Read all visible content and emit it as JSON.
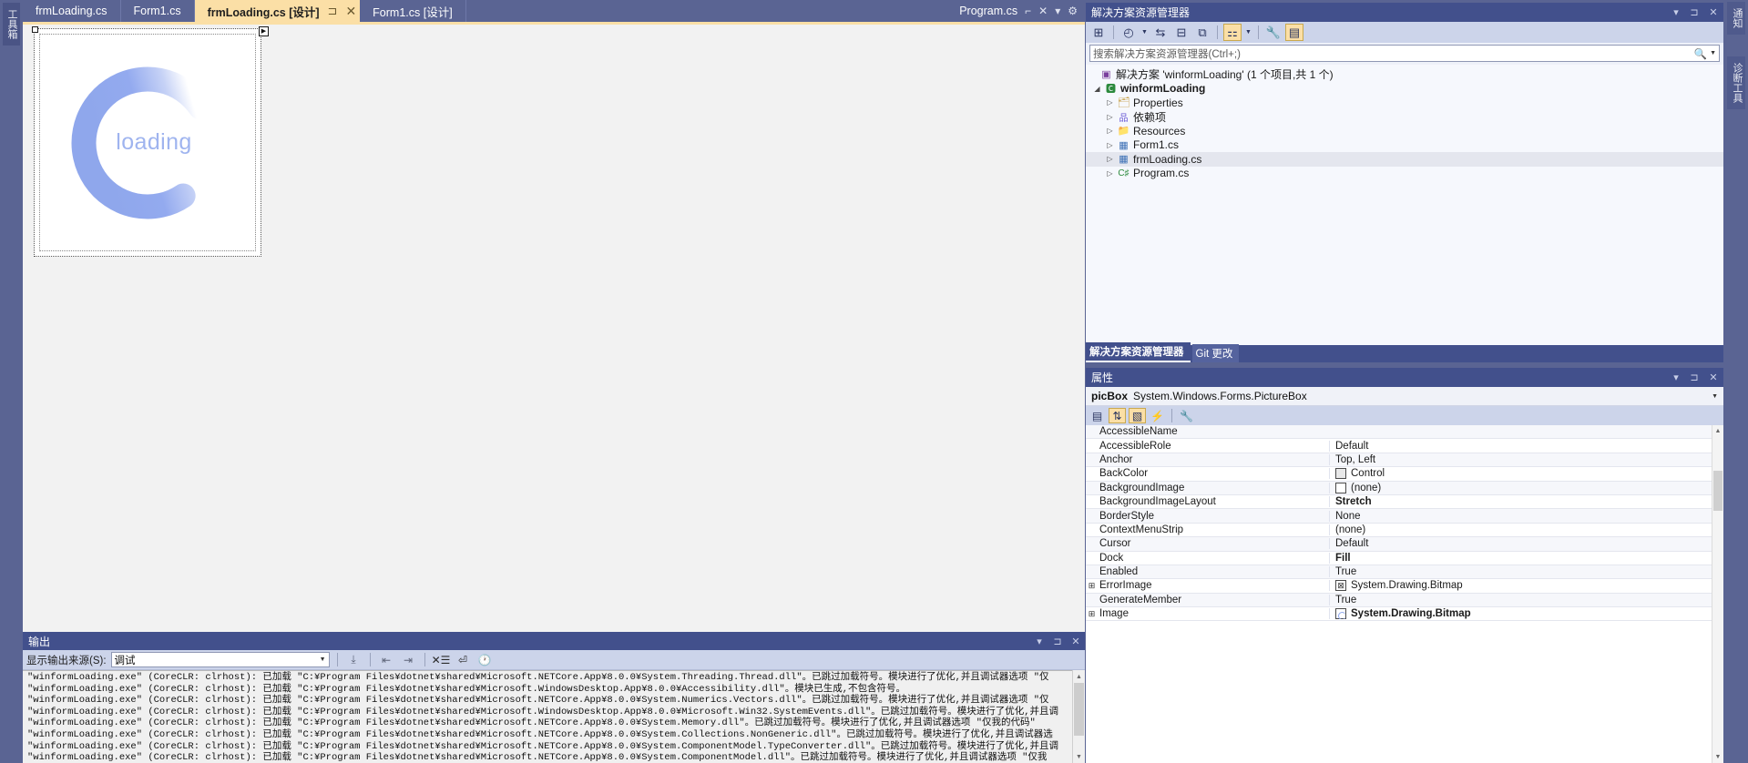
{
  "left_rail": {
    "toolbox_label": "工具箱"
  },
  "right_rail": {
    "notifications_label": "通知",
    "diagnostic_label": "诊断工具"
  },
  "tabbar": {
    "tabs": [
      {
        "label": "frmLoading.cs",
        "active": false
      },
      {
        "label": "Form1.cs",
        "active": false
      },
      {
        "label": "frmLoading.cs [设计]",
        "active": true,
        "pin": "⊐",
        "close": "✕"
      },
      {
        "label": "Form1.cs [设计]",
        "active": false
      }
    ],
    "right_group": {
      "label": "Program.cs",
      "pin_icon": "pin-icon",
      "close_icon": "✕",
      "dropdown_icon": "▾",
      "gear_icon": "⚙"
    }
  },
  "designer": {
    "form_name": "frmLoading",
    "spinner_text": "loading",
    "spinner_color": "#8fa7ec",
    "smart_tag_icon": "▶"
  },
  "output": {
    "title": "输出",
    "source_label": "显示输出来源(S):",
    "source_value": "调试",
    "toolbar_icons": [
      "jump-to-icon",
      "navigate-back-icon",
      "navigate-forward-icon",
      "clear-all-icon",
      "toggle-word-wrap-icon",
      "show-timestamps-icon"
    ],
    "titlebar_buttons": [
      "▾",
      "⊐",
      "✕"
    ],
    "lines": [
      "\"winformLoading.exe\" (CoreCLR: clrhost): 已加载 \"C:¥Program Files¥dotnet¥shared¥Microsoft.NETCore.App¥8.0.0¥System.Threading.Thread.dll\"。已跳过加载符号。模块进行了优化,并且调试器选项 \"仅",
      "\"winformLoading.exe\" (CoreCLR: clrhost): 已加载 \"C:¥Program Files¥dotnet¥shared¥Microsoft.WindowsDesktop.App¥8.0.0¥Accessibility.dll\"。模块已生成,不包含符号。",
      "\"winformLoading.exe\" (CoreCLR: clrhost): 已加载 \"C:¥Program Files¥dotnet¥shared¥Microsoft.NETCore.App¥8.0.0¥System.Numerics.Vectors.dll\"。已跳过加载符号。模块进行了优化,并且调试器选项 \"仅",
      "\"winformLoading.exe\" (CoreCLR: clrhost): 已加载 \"C:¥Program Files¥dotnet¥shared¥Microsoft.WindowsDesktop.App¥8.0.0¥Microsoft.Win32.SystemEvents.dll\"。已跳过加载符号。模块进行了优化,并且调",
      "\"winformLoading.exe\" (CoreCLR: clrhost): 已加载 \"C:¥Program Files¥dotnet¥shared¥Microsoft.NETCore.App¥8.0.0¥System.Memory.dll\"。已跳过加载符号。模块进行了优化,并且调试器选项 \"仅我的代码\"",
      "\"winformLoading.exe\" (CoreCLR: clrhost): 已加载 \"C:¥Program Files¥dotnet¥shared¥Microsoft.NETCore.App¥8.0.0¥System.Collections.NonGeneric.dll\"。已跳过加载符号。模块进行了优化,并且调试器选",
      "\"winformLoading.exe\" (CoreCLR: clrhost): 已加载 \"C:¥Program Files¥dotnet¥shared¥Microsoft.NETCore.App¥8.0.0¥System.ComponentModel.TypeConverter.dll\"。已跳过加载符号。模块进行了优化,并且调",
      "\"winformLoading.exe\" (CoreCLR: clrhost): 已加载 \"C:¥Program Files¥dotnet¥shared¥Microsoft.NETCore.App¥8.0.0¥System.ComponentModel.dll\"。已跳过加载符号。模块进行了优化,并且调试器选项 \"仅我"
    ]
  },
  "solution_explorer": {
    "title": "解决方案资源管理器",
    "titlebar_buttons": [
      "▾",
      "⊐",
      "✕"
    ],
    "toolbar_icons": [
      "home-icon",
      "pending-changes-icon",
      "sync-with-active-document-icon",
      "collapse-all-icon",
      "refresh-icon",
      "show-all-files-icon",
      "properties-wrench-icon",
      "preview-selected-items-icon"
    ],
    "search_placeholder": "搜索解决方案资源管理器(Ctrl+;)",
    "search_icon": "search-icon",
    "tree": [
      {
        "label": "解决方案 'winformLoading' (1 个项目,共 1 个)",
        "icon": "solution-icon",
        "indent": 0,
        "twist": "",
        "selected": false
      },
      {
        "label": "winformLoading",
        "icon": "csharp-project-icon",
        "indent": 1,
        "twist": "◢",
        "selected": false
      },
      {
        "label": "Properties",
        "icon": "properties-folder-icon",
        "indent": 2,
        "twist": "▷",
        "selected": false
      },
      {
        "label": "依赖项",
        "icon": "dependencies-icon",
        "indent": 2,
        "twist": "▷",
        "selected": false
      },
      {
        "label": "Resources",
        "icon": "folder-icon",
        "indent": 2,
        "twist": "▷",
        "selected": false
      },
      {
        "label": "Form1.cs",
        "icon": "form-icon",
        "indent": 2,
        "twist": "▷",
        "selected": false
      },
      {
        "label": "frmLoading.cs",
        "icon": "form-icon",
        "indent": 2,
        "twist": "▷",
        "selected": true
      },
      {
        "label": "Program.cs",
        "icon": "csharp-file-icon",
        "indent": 2,
        "twist": "▷",
        "selected": false
      }
    ],
    "bottom_tabs": [
      {
        "label": "解决方案资源管理器",
        "active": true
      },
      {
        "label": "Git 更改",
        "active": false
      }
    ]
  },
  "properties": {
    "title": "属性",
    "titlebar_buttons": [
      "▾",
      "⊐",
      "✕"
    ],
    "object_name": "picBox",
    "object_type": "System.Windows.Forms.PictureBox",
    "toolbar_icons": [
      "categorized-icon",
      "alphabetical-sort-icon",
      "properties-page-icon",
      "events-lightning-icon",
      "property-pages-icon"
    ],
    "rows": [
      {
        "name": "AccessibleName",
        "value": "",
        "expandable": false,
        "bold": false,
        "swatch": ""
      },
      {
        "name": "AccessibleRole",
        "value": "Default",
        "expandable": false,
        "bold": false,
        "swatch": ""
      },
      {
        "name": "Anchor",
        "value": "Top, Left",
        "expandable": false,
        "bold": false,
        "swatch": ""
      },
      {
        "name": "BackColor",
        "value": "Control",
        "expandable": false,
        "bold": false,
        "swatch": "control"
      },
      {
        "name": "BackgroundImage",
        "value": "(none)",
        "expandable": false,
        "bold": false,
        "swatch": "empty"
      },
      {
        "name": "BackgroundImageLayout",
        "value": "Stretch",
        "expandable": false,
        "bold": true,
        "swatch": ""
      },
      {
        "name": "BorderStyle",
        "value": "None",
        "expandable": false,
        "bold": false,
        "swatch": ""
      },
      {
        "name": "ContextMenuStrip",
        "value": "(none)",
        "expandable": false,
        "bold": false,
        "swatch": ""
      },
      {
        "name": "Cursor",
        "value": "Default",
        "expandable": false,
        "bold": false,
        "swatch": ""
      },
      {
        "name": "Dock",
        "value": "Fill",
        "expandable": false,
        "bold": true,
        "swatch": ""
      },
      {
        "name": "Enabled",
        "value": "True",
        "expandable": false,
        "bold": false,
        "swatch": ""
      },
      {
        "name": "ErrorImage",
        "value": "System.Drawing.Bitmap",
        "expandable": true,
        "bold": false,
        "swatch": "err"
      },
      {
        "name": "GenerateMember",
        "value": "True",
        "expandable": false,
        "bold": false,
        "swatch": ""
      },
      {
        "name": "Image",
        "value": "System.Drawing.Bitmap",
        "expandable": true,
        "bold": true,
        "swatch": "img"
      }
    ]
  }
}
